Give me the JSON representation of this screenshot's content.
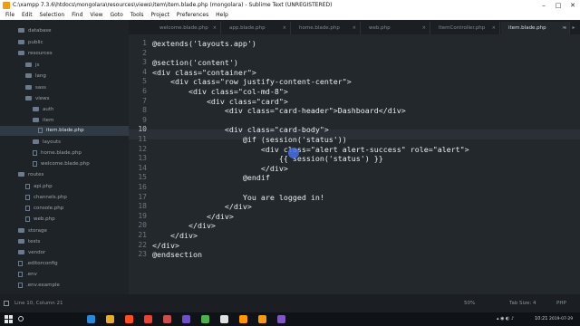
{
  "window": {
    "title": "C:\\xampp 7.3.6\\htdocs\\mongolara\\resources\\views\\item\\item.blade.php (mongolara) - Sublime Text (UNREGISTERED)",
    "controls": [
      "–",
      "□",
      "✕"
    ]
  },
  "menu": [
    "File",
    "Edit",
    "Selection",
    "Find",
    "View",
    "Goto",
    "Tools",
    "Project",
    "Preferences",
    "Help"
  ],
  "sidebar": {
    "items": [
      {
        "label": "database",
        "type": "folder"
      },
      {
        "label": "public",
        "type": "folder"
      },
      {
        "label": "resources",
        "type": "folder"
      },
      {
        "label": "js",
        "type": "folder"
      },
      {
        "label": "lang",
        "type": "folder"
      },
      {
        "label": "sass",
        "type": "folder"
      },
      {
        "label": "views",
        "type": "folder"
      },
      {
        "label": "auth",
        "type": "folder"
      },
      {
        "label": "item",
        "type": "folder"
      },
      {
        "label": "item.blade.php",
        "type": "file"
      },
      {
        "label": "layouts",
        "type": "folder"
      },
      {
        "label": "home.blade.php",
        "type": "file"
      },
      {
        "label": "welcome.blade.php",
        "type": "file"
      },
      {
        "label": "routes",
        "type": "folder"
      },
      {
        "label": "api.php",
        "type": "file"
      },
      {
        "label": "channels.php",
        "type": "file"
      },
      {
        "label": "console.php",
        "type": "file"
      },
      {
        "label": "web.php",
        "type": "file"
      },
      {
        "label": "storage",
        "type": "folder"
      },
      {
        "label": "tests",
        "type": "folder"
      },
      {
        "label": "vendor",
        "type": "folder"
      },
      {
        "label": ".editorconfig",
        "type": "file"
      },
      {
        "label": ".env",
        "type": "file"
      },
      {
        "label": ".env.example",
        "type": "file"
      }
    ]
  },
  "tabs": [
    {
      "label": "welcome.blade.php",
      "active": false
    },
    {
      "label": "app.blade.php",
      "active": false
    },
    {
      "label": "home.blade.php",
      "active": false
    },
    {
      "label": "web.php",
      "active": false
    },
    {
      "label": "ItemController.php",
      "active": false
    },
    {
      "label": "item.blade.php",
      "active": true
    }
  ],
  "tab_close": "×",
  "tab_nav": [
    "◂",
    "▸"
  ],
  "editor": {
    "current_line": 10,
    "lines": [
      "@extends('layouts.app')",
      "",
      "@section('content')",
      "<div class=\"container\">",
      "    <div class=\"row justify-content-center\">",
      "        <div class=\"col-md-8\">",
      "            <div class=\"card\">",
      "                <div class=\"card-header\">Dashboard</div>",
      "",
      "                <div class=\"card-body\">",
      "                    @if (session('status'))",
      "                        <div class=\"alert alert-success\" role=\"alert\">",
      "                            {{ session('status') }}",
      "                        </div>",
      "                    @endif",
      "",
      "                    You are logged in!",
      "                </div>",
      "            </div>",
      "        </div>",
      "    </div>",
      "</div>",
      "@endsection"
    ]
  },
  "status": {
    "position": "Line 10, Column 21",
    "zoom": "50%",
    "tab_size": "Tab Size: 4",
    "syntax": "PHP"
  },
  "taskbar": {
    "time": "10:21",
    "date": "2019-07-29",
    "icon_colors": [
      "#2b88d8",
      "#e8ac2c",
      "#ff4f1f",
      "#ea4335",
      "#c94f4f",
      "#6d4fc9",
      "#4caf50",
      "#e0e0e0",
      "#ff9800",
      "#f39c12",
      "#7e57c2"
    ]
  },
  "colors": {
    "editor_bg": "#23282d",
    "sidebar_bg": "#1e2327",
    "accent": "#f39c12",
    "cursor_highlight": "#466ee6"
  }
}
